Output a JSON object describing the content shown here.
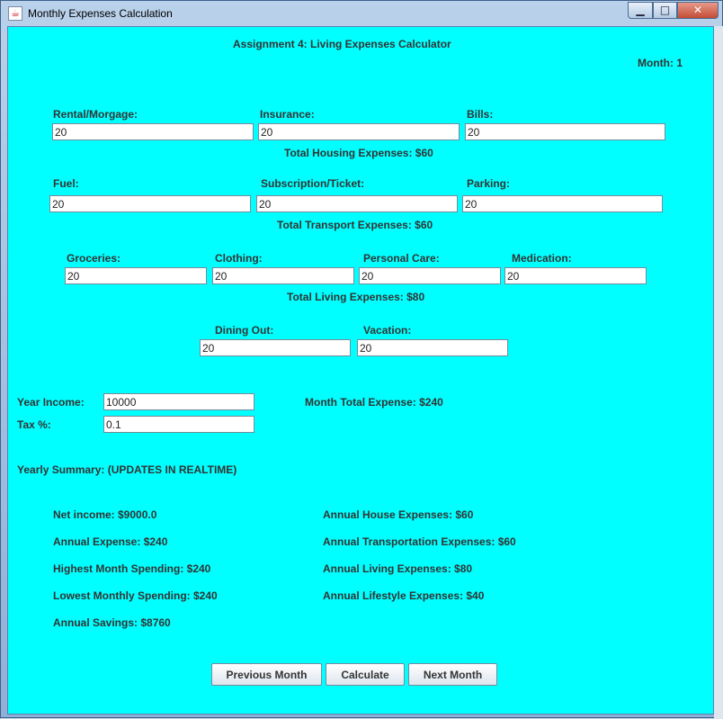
{
  "window": {
    "title": "Monthly Expenses Calculation"
  },
  "header": {
    "title": "Assignment 4: Living Expenses Calculator",
    "month": "Month: 1"
  },
  "housing": {
    "rental_label": "Rental/Morgage:",
    "rental_value": "20",
    "insurance_label": "Insurance:",
    "insurance_value": "20",
    "bills_label": "Bills:",
    "bills_value": "20",
    "total": "Total Housing Expenses:  $60"
  },
  "transport": {
    "fuel_label": "Fuel:",
    "fuel_value": "20",
    "subscription_label": "Subscription/Ticket:",
    "subscription_value": "20",
    "parking_label": "Parking:",
    "parking_value": "20",
    "total": "Total Transport Expenses:  $60"
  },
  "living": {
    "groceries_label": "Groceries:",
    "groceries_value": "20",
    "clothing_label": "Clothing:",
    "clothing_value": "20",
    "personal_care_label": "Personal Care:",
    "personal_care_value": "20",
    "medication_label": "Medication:",
    "medication_value": "20",
    "total": "Total Living Expenses:  $80"
  },
  "lifestyle": {
    "dining_label": "Dining Out:",
    "dining_value": "20",
    "vacation_label": "Vacation:",
    "vacation_value": "20"
  },
  "income": {
    "year_income_label": "Year Income:",
    "year_income_value": "10000",
    "tax_label": "Tax %:",
    "tax_value": "0.1",
    "month_total": "Month Total Expense: $240"
  },
  "summary": {
    "heading": "Yearly Summary: (UPDATES IN REALTIME)",
    "net_income": "Net income: $9000.0",
    "annual_expense": "Annual Expense: $240",
    "highest_month": "Highest Month Spending: $240",
    "lowest_month": "Lowest Monthly Spending: $240",
    "annual_savings": "Annual Savings: $8760",
    "annual_house": "Annual House Expenses: $60",
    "annual_transportation": "Annual Transportation Expenses: $60",
    "annual_living": "Annual Living Expenses: $80",
    "annual_lifestyle": "Annual Lifestyle Expenses: $40"
  },
  "buttons": {
    "previous": "Previous Month",
    "calculate": "Calculate",
    "next": "Next Month"
  },
  "icons": {
    "app": "java-coffee-icon",
    "minimize": "minimize-icon",
    "maximize": "maximize-icon",
    "close": "close-icon"
  },
  "colors": {
    "content_background": "#00ffff",
    "close_button": "#c34d35"
  }
}
